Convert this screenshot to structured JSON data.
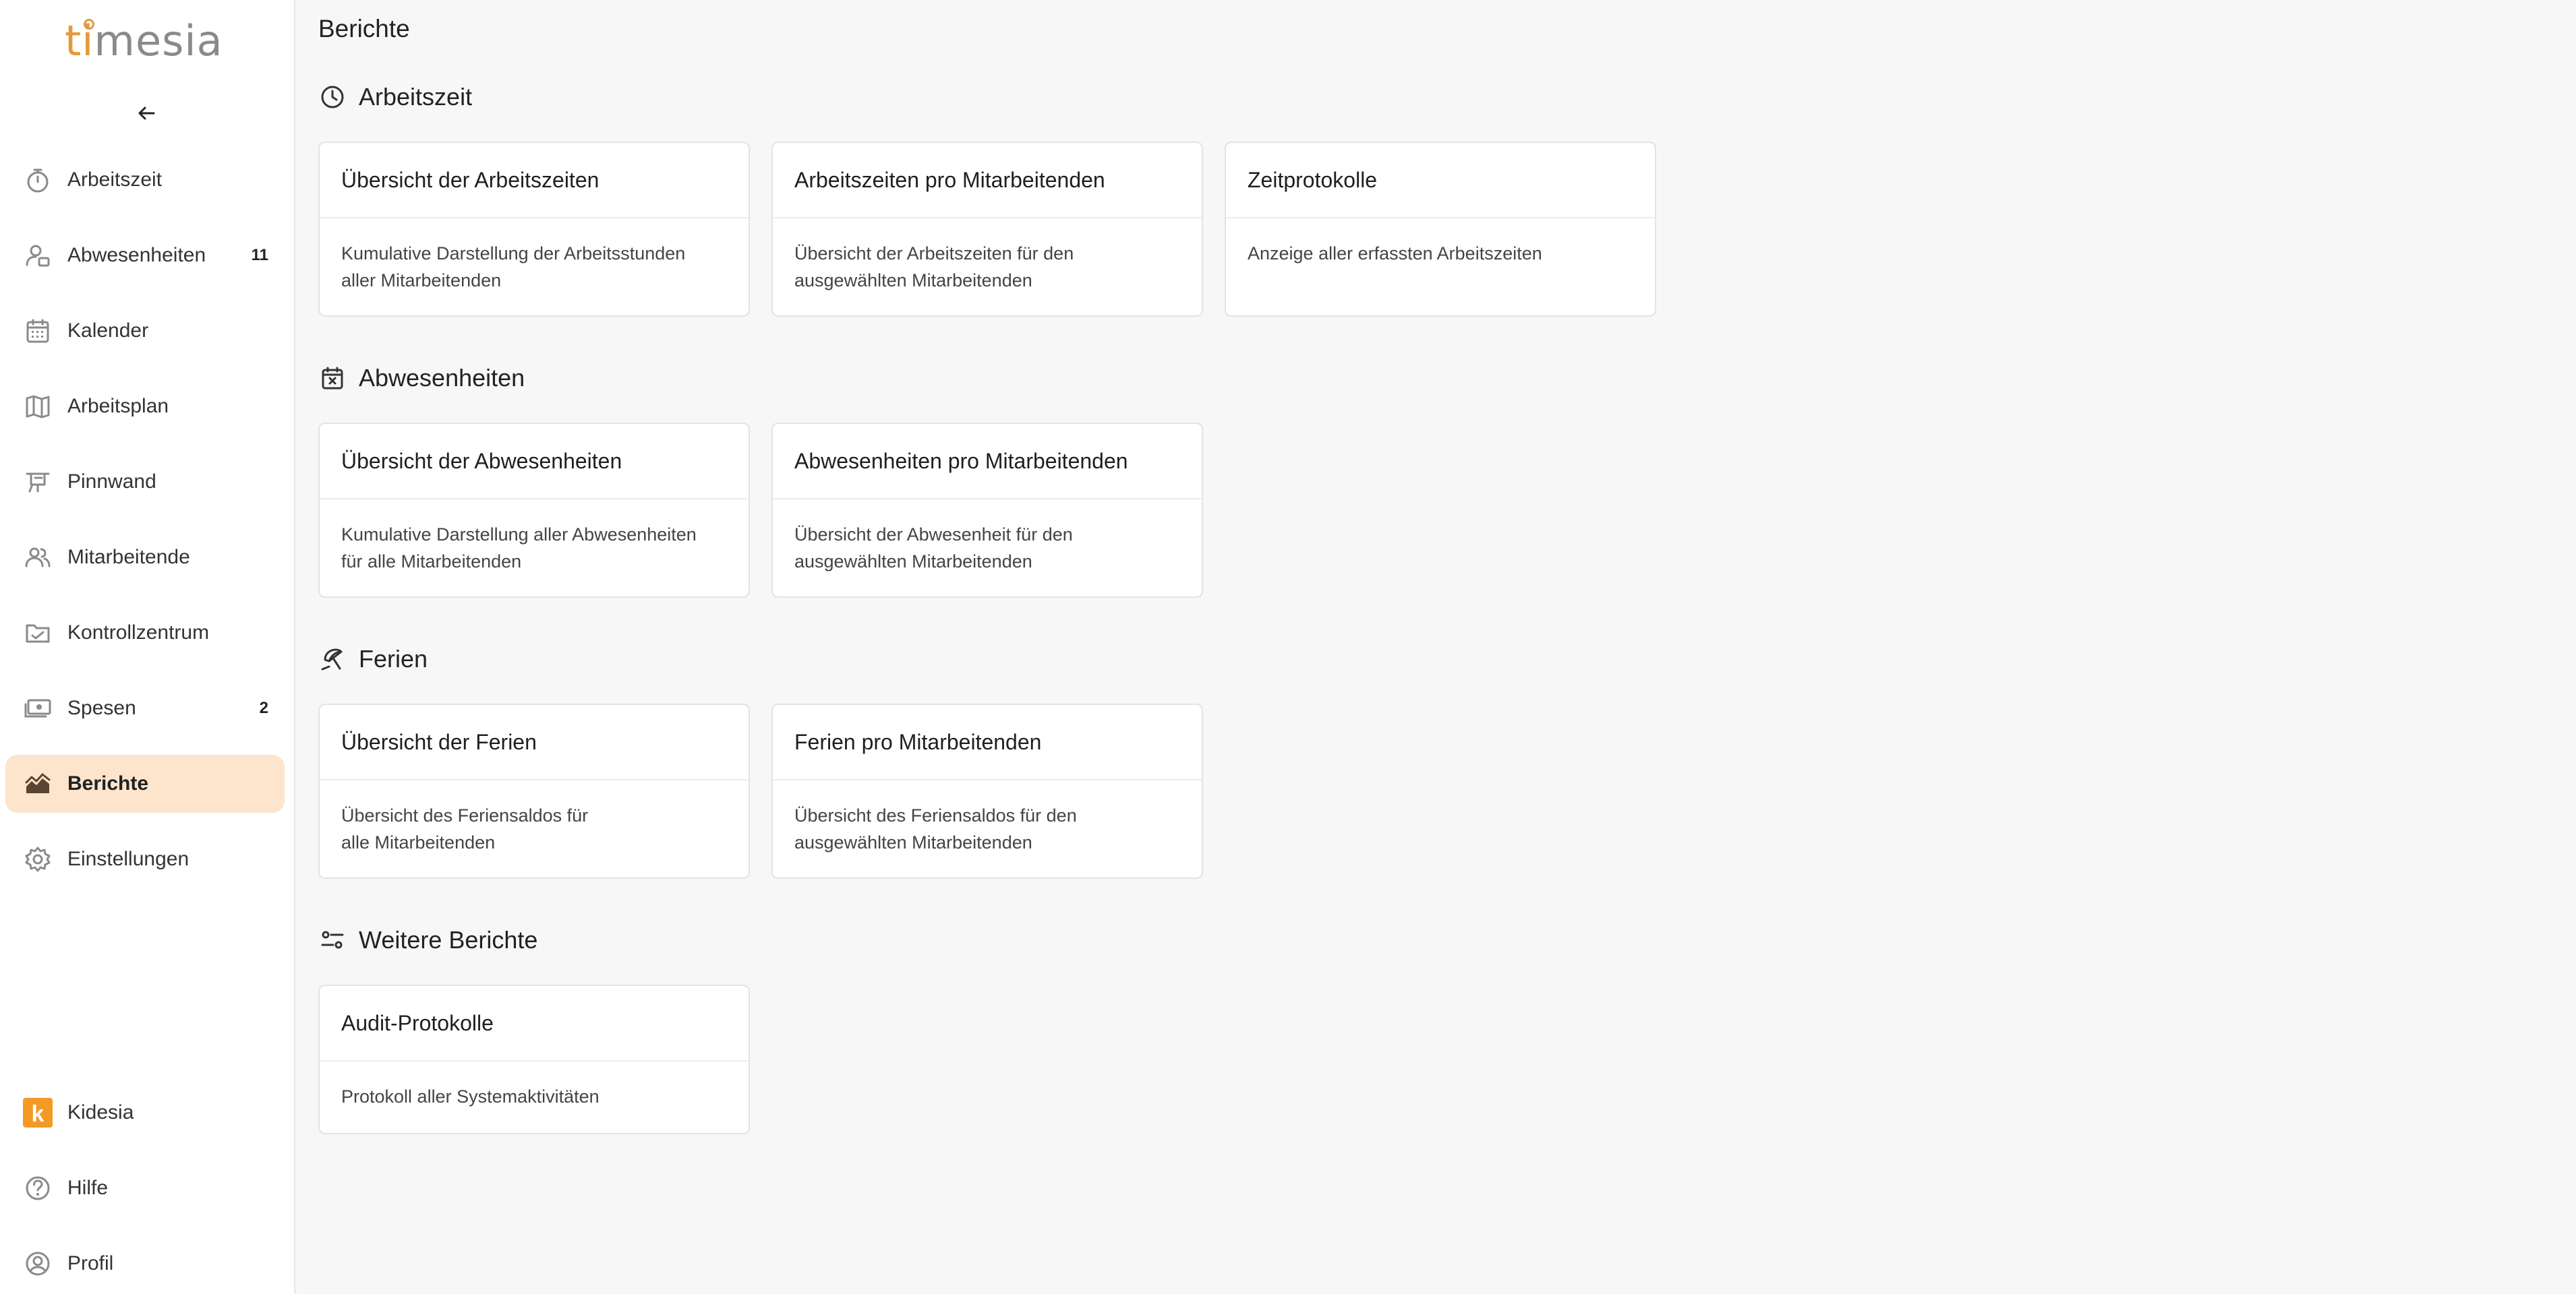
{
  "app": {
    "logo_text_a": "ti",
    "logo_text_b": "mesia"
  },
  "sidebar": {
    "back_icon": "arrow-left-icon",
    "items": [
      {
        "label": "Arbeitszeit",
        "icon": "stopwatch-icon",
        "badge": ""
      },
      {
        "label": "Abwesenheiten",
        "icon": "user-absence-icon",
        "badge": "11"
      },
      {
        "label": "Kalender",
        "icon": "calendar-icon",
        "badge": ""
      },
      {
        "label": "Arbeitsplan",
        "icon": "map-icon",
        "badge": ""
      },
      {
        "label": "Pinnwand",
        "icon": "pin-board-icon",
        "badge": ""
      },
      {
        "label": "Mitarbeitende",
        "icon": "users-icon",
        "badge": ""
      },
      {
        "label": "Kontrollzentrum",
        "icon": "folder-check-icon",
        "badge": ""
      },
      {
        "label": "Spesen",
        "icon": "money-icon",
        "badge": "2"
      },
      {
        "label": "Berichte",
        "icon": "report-chart-icon",
        "badge": "",
        "active": true
      },
      {
        "label": "Einstellungen",
        "icon": "gear-icon",
        "badge": ""
      }
    ],
    "bottom_items": [
      {
        "label": "Kidesia",
        "icon": "kidesia-logo-icon",
        "logo_letter": "k"
      },
      {
        "label": "Hilfe",
        "icon": "help-circle-icon"
      },
      {
        "label": "Profil",
        "icon": "user-circle-icon"
      }
    ]
  },
  "main": {
    "title": "Berichte",
    "sections": [
      {
        "title": "Arbeitszeit",
        "icon": "clock-icon",
        "cards": [
          {
            "title": "Übersicht der Arbeitszeiten",
            "description": "Kumulative Darstellung der Arbeitsstunden\naller Mitarbeitenden"
          },
          {
            "title": "Arbeitszeiten pro Mitarbeitenden",
            "description": "Übersicht der Arbeitszeiten für den\nausgewählten Mitarbeitenden"
          },
          {
            "title": "Zeitprotokolle",
            "description": "Anzeige aller erfassten Arbeitszeiten"
          }
        ]
      },
      {
        "title": "Abwesenheiten",
        "icon": "calendar-x-icon",
        "cards": [
          {
            "title": "Übersicht der Abwesenheiten",
            "description": "Kumulative Darstellung aller Abwesenheiten\nfür alle Mitarbeitenden"
          },
          {
            "title": "Abwesenheiten pro Mitarbeitenden",
            "description": "Übersicht der Abwesenheit für den\nausgewählten Mitarbeitenden"
          }
        ]
      },
      {
        "title": "Ferien",
        "icon": "beach-umbrella-icon",
        "cards": [
          {
            "title": "Übersicht der Ferien",
            "description": "Übersicht des Feriensaldos für\nalle Mitarbeitenden"
          },
          {
            "title": "Ferien pro Mitarbeitenden",
            "description": "Übersicht des Feriensaldos für den\nausgewählten Mitarbeitenden"
          }
        ]
      },
      {
        "title": "Weitere Berichte",
        "icon": "sliders-icon",
        "cards": [
          {
            "title": "Audit-Protokolle",
            "description": "Protokoll aller Systemaktivitäten"
          }
        ]
      }
    ]
  },
  "colors": {
    "accent": "#e39a3b",
    "active_bg": "#fde4cc",
    "background": "#f7f7f7",
    "kidesia_orange": "#f39a26"
  }
}
